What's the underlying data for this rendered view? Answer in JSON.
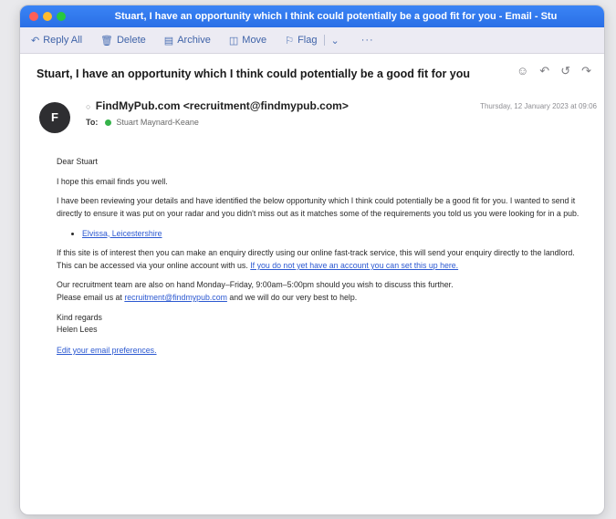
{
  "window": {
    "title": "Stuart, I have an opportunity which I think could potentially be a good fit for you - Email - Stu"
  },
  "toolbar": {
    "reply_all": "Reply All",
    "delete": "Delete",
    "archive": "Archive",
    "move": "Move",
    "flag": "Flag",
    "more": "···"
  },
  "message": {
    "subject": "Stuart, I have an opportunity which I think could potentially be a good fit for you",
    "avatar_initial": "F",
    "from": "FindMyPub.com <recruitment@findmypub.com>",
    "to_label": "To:",
    "to_name": "Stuart Maynard-Keane",
    "date": "Thursday, 12 January 2023 at 09:06"
  },
  "body": {
    "greeting": "Dear Stuart",
    "line1": "I hope this email finds you well.",
    "para1": "I have been reviewing your details and have identified the below opportunity which I think could potentially be a good fit for you. I wanted to send it directly to ensure it was put on your radar and you didn't miss out as it matches some of the requirements you told us you were looking for in a pub.",
    "bullet_link": "Elvissa, Leicestershire",
    "para2_text": "If this site is of interest then you can make an enquiry directly using our online fast-track service, this will send your enquiry directly to the landlord. This can be accessed via your online account with us.",
    "para2_link": "If you do not yet have an account you can set this up here.",
    "para3_line1": "Our recruitment team are also on hand Monday–Friday, 9:00am–5:00pm should you wish to discuss this further.",
    "para3_prefix": "Please email us at",
    "para3_email": "recruitment@findmypub.com",
    "para3_suffix": "and we will do our very best to help.",
    "regards": "Kind regards",
    "signature": "Helen Lees",
    "prefs_link": "Edit your email preferences."
  }
}
